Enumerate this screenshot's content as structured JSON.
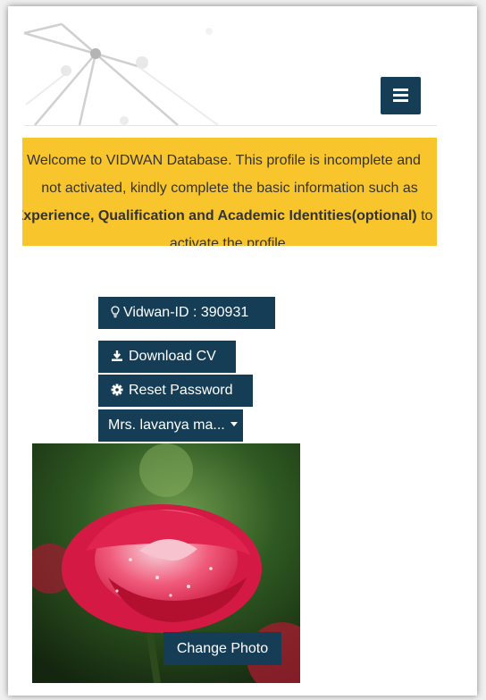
{
  "header": {
    "menu_icon": "hamburger-menu-icon",
    "brand_color": "#153e56"
  },
  "notice": {
    "line1": "Welcome to VIDWAN Database. This profile is incomplete and",
    "line2": "not activated, kindly complete the basic information such as",
    "line3_bold": "Experience, Qualification and Academic Identities(optional)",
    "line3_rest": " to",
    "line4": "activate the profile.",
    "background": "#f8c52c"
  },
  "profile": {
    "vidwan_id": "Vidwan-ID : 390931",
    "vidwan_icon": "lightbulb-icon",
    "download_cv": "Download CV",
    "download_icon": "download-icon",
    "reset_password": "Reset Password",
    "reset_icon": "gear-icon",
    "user_name": "Mrs. lavanya ma...",
    "change_photo": "Change Photo"
  }
}
